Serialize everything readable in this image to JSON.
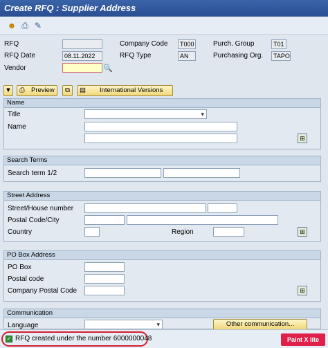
{
  "window": {
    "title": "Create RFQ : Supplier Address"
  },
  "toolbar": {
    "icons": [
      "person-icon",
      "printer-icon",
      "edit-icon"
    ]
  },
  "header": {
    "rfq_label": "RFQ",
    "rfq_value": "",
    "rfq_date_label": "RFQ Date",
    "rfq_date_value": "08.11.2022",
    "vendor_label": "Vendor",
    "vendor_value": "",
    "company_code_label": "Company Code",
    "company_code_value": "T000",
    "rfq_type_label": "RFQ Type",
    "rfq_type_value": "AN",
    "purch_group_label": "Purch. Group",
    "purch_group_value": "T01",
    "purch_org_label": "Purchasing Org.",
    "purch_org_value": "TAPO"
  },
  "actions": {
    "preview": "Preview",
    "intl": "International Versions"
  },
  "name_section": {
    "title": "Name",
    "title_label": "Title",
    "name_label": "Name"
  },
  "search_section": {
    "title": "Search Terms",
    "term_label": "Search term 1/2"
  },
  "street_section": {
    "title": "Street Address",
    "street_label": "Street/House number",
    "postal_label": "Postal Code/City",
    "country_label": "Country",
    "region_label": "Region"
  },
  "pobox_section": {
    "title": "PO Box Address",
    "pobox_label": "PO Box",
    "postal_label": "Postal code",
    "company_postal_label": "Company Postal Code"
  },
  "comm_section": {
    "title": "Communication",
    "language_label": "Language",
    "other_button": "Other communication..."
  },
  "status": {
    "message": "RFQ created under the number 6000000048"
  },
  "watermark": "Paint X lite"
}
